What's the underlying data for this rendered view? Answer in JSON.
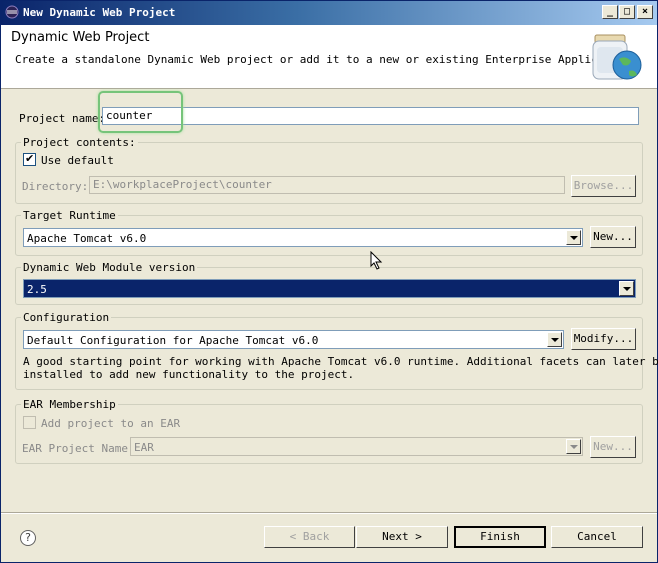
{
  "window": {
    "title": "New Dynamic Web Project",
    "minimize_glyph": "_",
    "maximize_glyph": "□",
    "close_glyph": "×"
  },
  "header": {
    "title": "Dynamic Web Project",
    "description": "Create a standalone Dynamic Web project or add it to a new or existing Enterprise Application."
  },
  "project_name": {
    "label": "Project name:",
    "value": "counter"
  },
  "project_contents": {
    "title": "Project contents:",
    "use_default_label": "Use default",
    "use_default_checked": true,
    "directory_label": "Directory:",
    "directory_value": "E:\\workplaceProject\\counter",
    "browse_label": "Browse..."
  },
  "target_runtime": {
    "title": "Target Runtime",
    "selected": "Apache Tomcat v6.0",
    "new_label": "New..."
  },
  "web_module": {
    "title": "Dynamic Web Module version",
    "selected": "2.5"
  },
  "configuration": {
    "title": "Configuration",
    "selected": "Default Configuration for Apache Tomcat v6.0",
    "modify_label": "Modify...",
    "description_line1": "A good starting point for working with Apache Tomcat v6.0 runtime. Additional facets can later be",
    "description_line2": "installed to add new functionality to the project."
  },
  "ear": {
    "title": "EAR Membership",
    "add_label": "Add project to an EAR",
    "add_checked": false,
    "name_label": "EAR Project Name:",
    "name_value": "EAR",
    "new_label": "New..."
  },
  "footer": {
    "help_glyph": "?",
    "back_label": "< Back",
    "next_label": "Next >",
    "finish_label": "Finish",
    "cancel_label": "Cancel"
  }
}
